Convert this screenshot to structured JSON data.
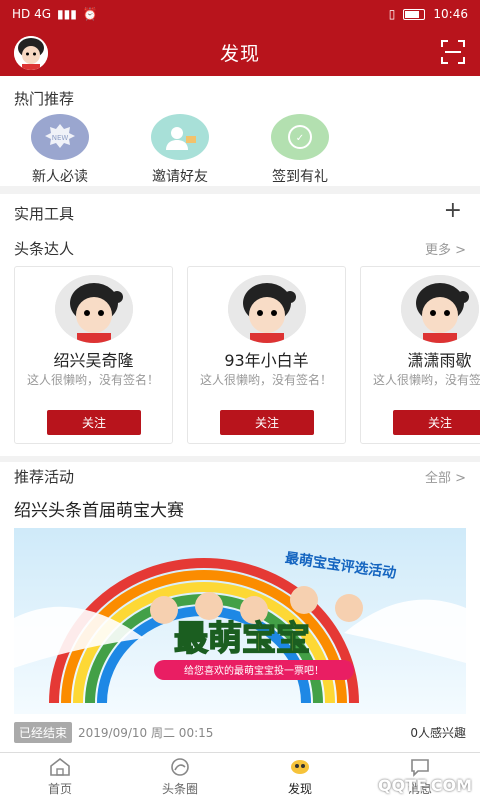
{
  "status": {
    "left": "HD 4G",
    "time": "10:46"
  },
  "header": {
    "title": "发现"
  },
  "hot": {
    "title": "热门推荐",
    "items": [
      {
        "label": "新人必读",
        "icon": "new-badge-icon",
        "color": "#8f9fc6"
      },
      {
        "label": "邀请好友",
        "icon": "invite-friend-icon",
        "color": "#7fd3c8"
      },
      {
        "label": "签到有礼",
        "icon": "checkin-gift-icon",
        "color": "#9bd49a"
      }
    ]
  },
  "tools": {
    "title": "实用工具",
    "add": "+"
  },
  "experts": {
    "title": "头条达人",
    "more": "更多 >",
    "cards": [
      {
        "name": "绍兴吴奇隆",
        "desc": "这人很懒哟，没有签名！",
        "follow": "关注"
      },
      {
        "name": "93年小白羊",
        "desc": "这人很懒哟，没有签名！",
        "follow": "关注"
      },
      {
        "name": "潇潇雨歇",
        "desc": "这人很懒哟，没有签名！",
        "follow": "关注"
      }
    ]
  },
  "activities": {
    "title": "推荐活动",
    "more": "全部 >",
    "item": {
      "title": "绍兴头条首届萌宝大赛",
      "banner_heading": "最萌宝宝评选活动",
      "banner_main": "最萌宝宝",
      "banner_sub": "给您喜欢的最萌宝宝投一票吧！",
      "status": "已经结束",
      "date": "2019/09/10 周二 00:15",
      "interest": "0人感兴趣"
    }
  },
  "tabs": [
    {
      "label": "首页",
      "icon": "home-icon"
    },
    {
      "label": "头条圈",
      "icon": "circle-icon"
    },
    {
      "label": "发现",
      "icon": "discover-icon"
    },
    {
      "label": "消息",
      "icon": "message-icon"
    }
  ],
  "watermark": "QQTF.COM",
  "colors": {
    "brand": "#b8141c"
  }
}
